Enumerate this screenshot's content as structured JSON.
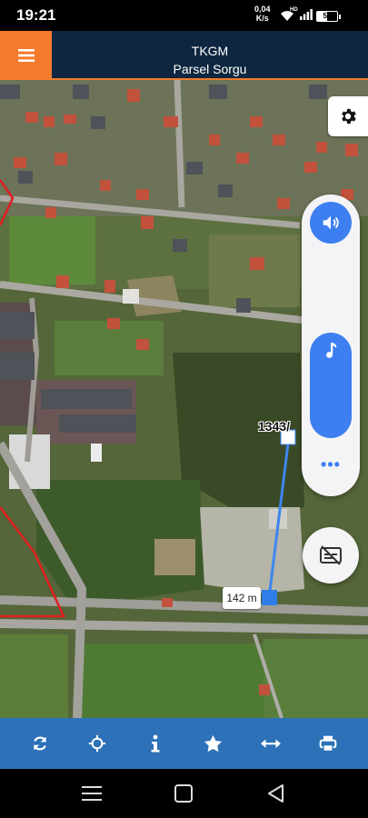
{
  "status_bar": {
    "time": "19:21",
    "net_speed_value": "0,04",
    "net_speed_unit": "K/s",
    "network_type": "HD",
    "battery_level": "50",
    "icons": [
      "wifi-icon",
      "signal-icon",
      "battery-icon"
    ]
  },
  "header": {
    "title": "TKGM",
    "subtitle": "Parsel Sorgu",
    "menu_icon": "hamburger-menu-icon",
    "accent_color": "#f47a2c",
    "bar_color": "#0e2640"
  },
  "map": {
    "parcel_number": "1343/",
    "distance": "142 m",
    "measure_line_color": "#3d86f0",
    "parcel_outline_color": "#e01e1e",
    "settings_icon": "gear-icon"
  },
  "sound_panel": {
    "volume_icon": "speaker-icon",
    "music_icon": "music-note-icon",
    "more_label": "•••",
    "caption_icon": "captions-off-icon",
    "accent_color": "#3d7ff0"
  },
  "toolbar": {
    "color": "#2d71b8",
    "buttons": [
      {
        "name": "refresh",
        "icon": "refresh-icon"
      },
      {
        "name": "locate",
        "icon": "crosshair-icon"
      },
      {
        "name": "info",
        "icon": "info-icon"
      },
      {
        "name": "favorite",
        "icon": "star-icon"
      },
      {
        "name": "measure",
        "icon": "horizontal-arrows-icon"
      },
      {
        "name": "print",
        "icon": "printer-icon"
      }
    ]
  },
  "nav_bar": {
    "buttons": [
      "recent-apps-icon",
      "home-icon",
      "back-icon"
    ]
  }
}
